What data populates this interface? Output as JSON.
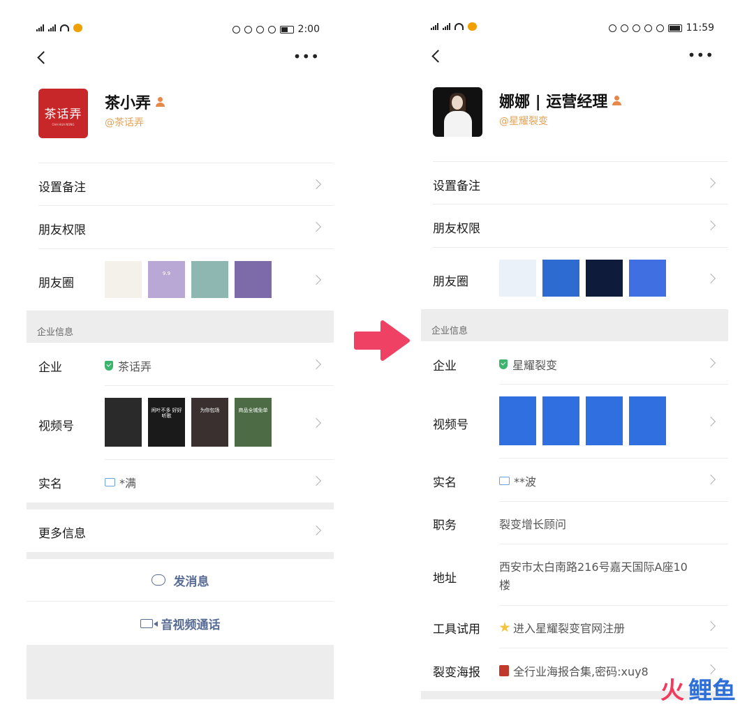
{
  "left": {
    "status": {
      "time": "2:00"
    },
    "profile": {
      "name": "茶小弄",
      "corp": "@茶话弄",
      "avatar_text": "茶话弄",
      "avatar_sub": "CHA HUA NONG"
    },
    "rows": {
      "remark": "设置备注",
      "permission": "朋友权限",
      "moments": "朋友圈"
    },
    "moments_thumbs": [
      {
        "text": "",
        "color": "#f4f1ea"
      },
      {
        "text": "9.9",
        "color": "#b9a7d6"
      },
      {
        "text": "",
        "color": "#8fb7b1"
      },
      {
        "text": "",
        "color": "#7d6aa8"
      }
    ],
    "section_title": "企业信息",
    "company": {
      "label": "企业",
      "value": "茶话弄"
    },
    "channels": {
      "label": "视频号"
    },
    "channel_thumbs": [
      {
        "text": "",
        "color": "#2a2a2a"
      },
      {
        "text": "闲叶不多 好好听歌",
        "color": "#1a1a1a"
      },
      {
        "text": "为你包场",
        "color": "#3a3030"
      },
      {
        "text": "商品全城免单",
        "color": "#4d6b45"
      }
    ],
    "realname": {
      "label": "实名",
      "value": "*满"
    },
    "more_info": "更多信息",
    "actions": {
      "message": "发消息",
      "call": "音视频通话"
    }
  },
  "right": {
    "status": {
      "time": "11:59"
    },
    "profile": {
      "name": "娜娜 | 运营经理",
      "corp": "@星耀裂变"
    },
    "rows": {
      "remark": "设置备注",
      "permission": "朋友权限",
      "moments": "朋友圈"
    },
    "moments_thumbs": [
      {
        "color": "#eaf1f8"
      },
      {
        "color": "#2d6bd1"
      },
      {
        "color": "#0e1b3a"
      },
      {
        "color": "#3f6fe0"
      }
    ],
    "section_title": "企业信息",
    "company": {
      "label": "企业",
      "value": "星耀裂变"
    },
    "channels": {
      "label": "视频号"
    },
    "channel_thumbs": [
      {
        "color": "#2f6fe0"
      },
      {
        "color": "#2f6fe0"
      },
      {
        "color": "#2f6fe0"
      },
      {
        "color": "#2f6fe0"
      }
    ],
    "realname": {
      "label": "实名",
      "value": "**波"
    },
    "position": {
      "label": "职务",
      "value": "裂变增长顾问"
    },
    "address": {
      "label": "地址",
      "value_line1": "西安市太白南路216号嘉天国际A座10",
      "value_line2": "楼"
    },
    "trial": {
      "label": "工具试用",
      "value": "进入星耀裂变官网注册"
    },
    "poster": {
      "label": "裂变海报",
      "value": "全行业海报合集,密码:xuy8"
    }
  },
  "colors": {
    "arrow": "#ee4163",
    "link": "#576b95",
    "verified": "#3cb46e",
    "corp": "#e2a256"
  },
  "watermark": {
    "brand1": "火",
    "brand2": "鲤鱼"
  }
}
